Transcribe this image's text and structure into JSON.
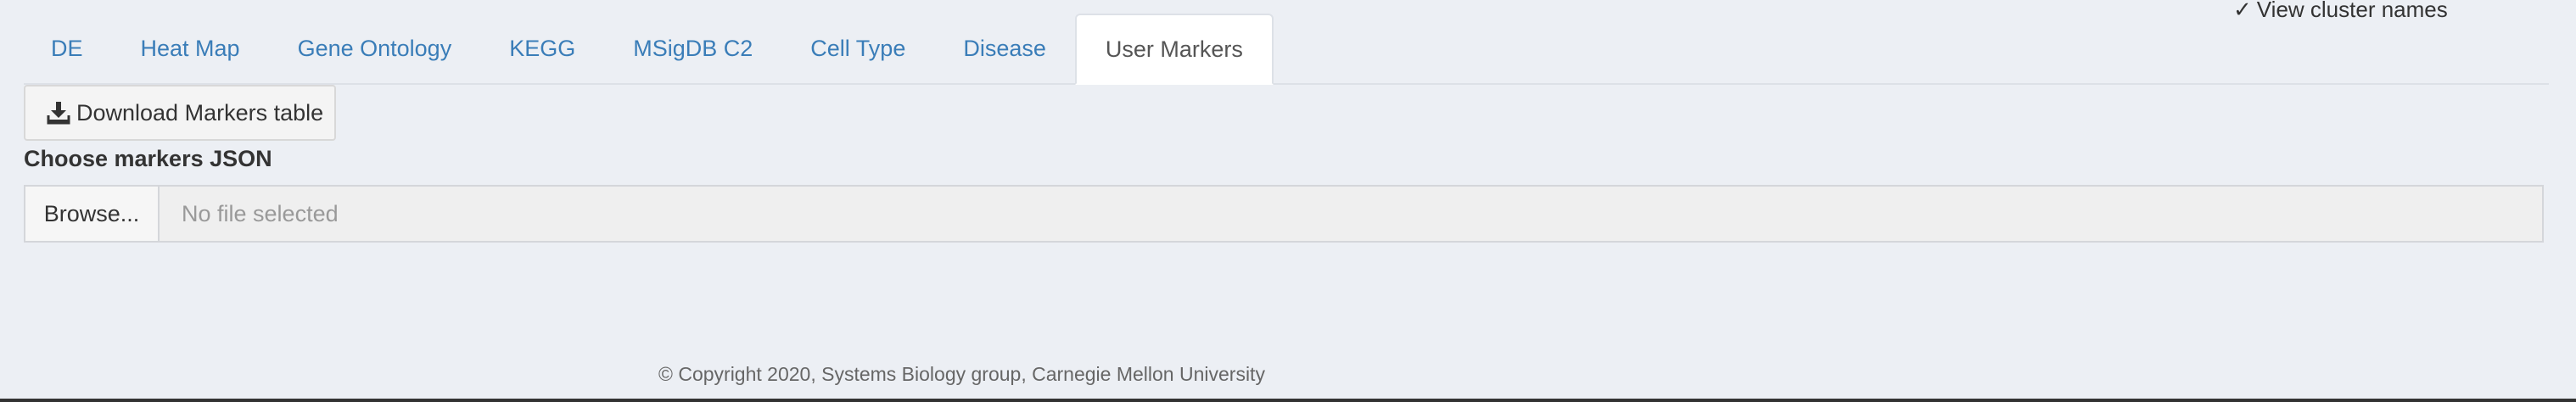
{
  "top_right_link": {
    "check": "✓",
    "label": "View cluster names"
  },
  "tabs": [
    {
      "label": "DE",
      "active": false
    },
    {
      "label": "Heat Map",
      "active": false
    },
    {
      "label": "Gene Ontology",
      "active": false
    },
    {
      "label": "KEGG",
      "active": false
    },
    {
      "label": "MSigDB C2",
      "active": false
    },
    {
      "label": "Cell Type",
      "active": false
    },
    {
      "label": "Disease",
      "active": false
    },
    {
      "label": "User Markers",
      "active": true
    }
  ],
  "download_button": {
    "label": "Download Markers table",
    "icon": "download-icon"
  },
  "file_input": {
    "label": "Choose markers JSON",
    "browse_label": "Browse...",
    "placeholder": "No file selected"
  },
  "footer": {
    "text": "© Copyright 2020, Systems Biology group, Carnegie Mellon University"
  },
  "colors": {
    "background": "#eceff4",
    "tab_link": "#3a7db8",
    "active_tab_bg": "#ffffff"
  }
}
